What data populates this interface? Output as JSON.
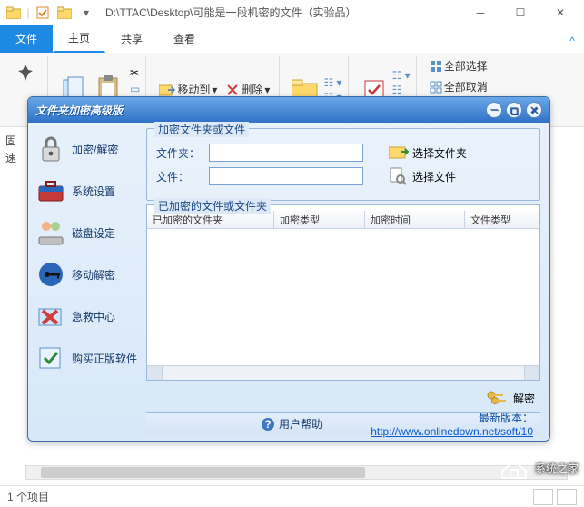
{
  "titlebar": {
    "path": "D:\\TTAC\\Desktop\\可能是一段机密的文件（实验品）"
  },
  "tabs": {
    "file": "文件",
    "home": "主页",
    "share": "共享",
    "view": "查看"
  },
  "ribbon": {
    "moveTo": "移动到",
    "delete": "删除",
    "selectAll": "全部选择",
    "selectNone": "全部取消"
  },
  "leftcol": {
    "l1": "固",
    "l2": "速"
  },
  "dialog": {
    "title": "文件夹加密高级版",
    "sidebar": {
      "encrypt": "加密/解密",
      "settings": "系统设置",
      "disk": "磁盘设定",
      "mobile": "移动解密",
      "rescue": "急救中心",
      "buy": "购买正版软件"
    },
    "fieldset1": {
      "legend": "加密文件夹或文件",
      "folderLabel": "文件夹：",
      "fileLabel": "文件：",
      "folderValue": "",
      "fileValue": "",
      "pickFolder": "选择文件夹",
      "pickFile": "选择文件"
    },
    "fieldset2": {
      "legend": "已加密的文件或文件夹",
      "cols": [
        "已加密的文件夹",
        "加密类型",
        "加密时间",
        "文件类型"
      ]
    },
    "decrypt": "解密",
    "footer": {
      "help": "用户帮助",
      "version_prefix": "最新版本：",
      "version_url": "http://www.onlinedown.net/soft/10"
    }
  },
  "statusbar": {
    "count": "1 个项目"
  },
  "watermark": "系统之家"
}
